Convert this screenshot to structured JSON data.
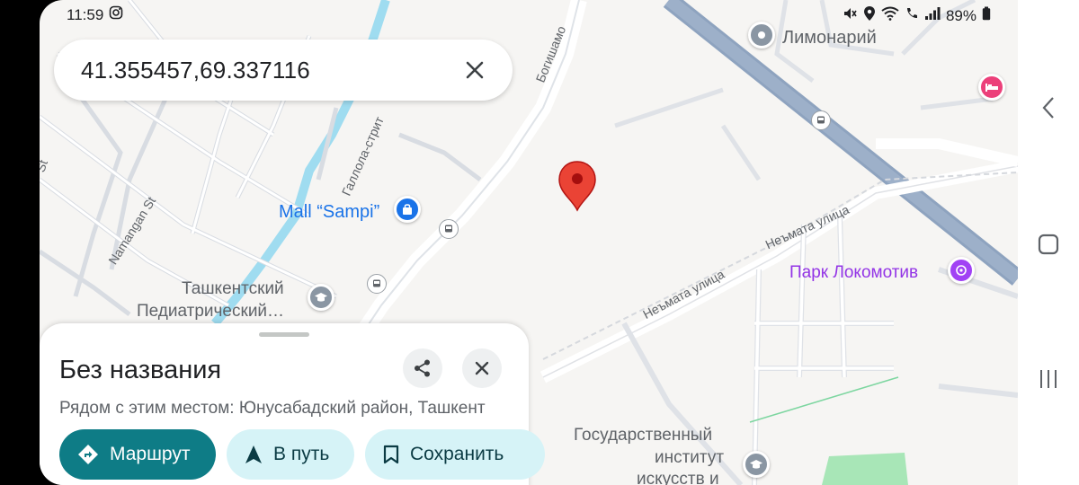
{
  "status_bar": {
    "time": "11:59",
    "battery": "89%"
  },
  "search": {
    "value": "41.355457,69.337116"
  },
  "map": {
    "labels": {
      "limonariy": "Лимонарий",
      "mall": "Mall “Sampi”",
      "tashkent_1": "Ташкентский",
      "tashkent_2": "Педиатрический…",
      "park": "Парк Локомотив",
      "institute_1": "Государственный",
      "institute_2": "институт",
      "institute_3": "искусств и"
    },
    "streets": {
      "bogishamol": "Богишамо",
      "gallola": "Галлола-стрит",
      "namangan": "Namangan St",
      "nematа_1": "Неъмата улица",
      "nemata_2": "Неъмата улица",
      "st_fragment": "St"
    }
  },
  "sheet": {
    "title": "Без названия",
    "subtitle": "Рядом с этим местом: Юнусабадский район, Ташкент",
    "route_label": "Маршрут",
    "go_label": "В путь",
    "save_label": "Сохранить"
  },
  "icons": {
    "share": "share-icon",
    "close": "close-icon",
    "route": "directions-icon",
    "navigate": "navigation-arrow-icon",
    "save": "bookmark-icon"
  },
  "colors": {
    "accent": "#0e7c86",
    "pin": "#ea4335",
    "highway": "#8ea3bf",
    "water": "#9fdcf0"
  }
}
